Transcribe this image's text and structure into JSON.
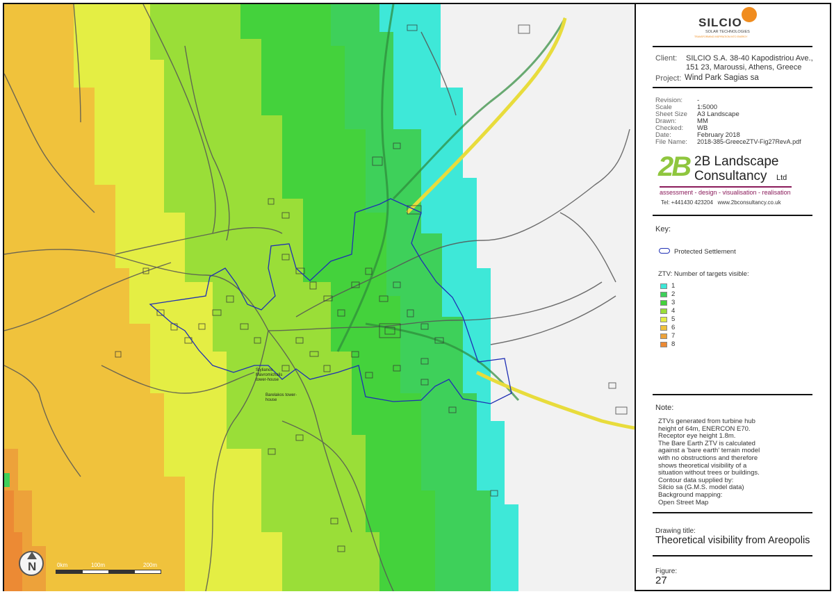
{
  "map": {
    "scale_bar": {
      "labels": [
        "0km",
        "100m",
        "200m"
      ]
    },
    "place_labels": [
      "Stylianos Mavromichalis tower-house",
      "Barelakos tower-house"
    ],
    "north_arrow_letter": "N",
    "colors": {
      "band_1": "#3ee8d8",
      "band_2": "#3ed05a",
      "band_3": "#44d23c",
      "band_4": "#9ade38",
      "band_5": "#e4ee44",
      "band_6": "#f0c23c",
      "band_7": "#eda23a",
      "band_8": "#ec8a34",
      "protected_settlement": "#1f2fb4",
      "road_main": "#e8dc3c"
    }
  },
  "panel": {
    "logo": {
      "name": "SILCIO",
      "sub": "SOLAR TECHNOLOGIES",
      "tagline": "TRANSFORMING INSPIRATION INTO ENERGY"
    },
    "client_label": "Client:",
    "client_value_line1": "SILCIO S.A. 38-40 Kapodistriou Ave.,",
    "client_value_line2": "151 23, Maroussi, Athens, Greece",
    "project_label": "Project:",
    "project_value": "Wind Park Sagias sa",
    "meta": [
      {
        "key": "Revision:",
        "value": "-"
      },
      {
        "key": "Scale",
        "value": "1:5000"
      },
      {
        "key": "Sheet Size",
        "value": "A3 Landscape"
      },
      {
        "key": "Drawn:",
        "value": "MM"
      },
      {
        "key": "Checked:",
        "value": "WB"
      },
      {
        "key": "Date:",
        "value": "February 2018"
      },
      {
        "key": "File Name:",
        "value": "2018-385-GreeceZTV-Fig27RevA.pdf"
      }
    ],
    "consultancy": {
      "mark": "2B",
      "line1": "2B Landscape",
      "line2": "Consultancy",
      "ltd": "Ltd",
      "services": "assessment - design - visualisation - realisation",
      "contact": "Tel: +441430 423204   www.2bconsultancy.co.uk"
    },
    "key_title": "Key:",
    "protected_label": "Protected Settlement",
    "ztv_title": "ZTV: Number of targets visible:",
    "ztv_items": [
      {
        "n": "1",
        "color": "#3ee8d8"
      },
      {
        "n": "2",
        "color": "#3ed05a"
      },
      {
        "n": "3",
        "color": "#44d23c"
      },
      {
        "n": "4",
        "color": "#9ade38"
      },
      {
        "n": "5",
        "color": "#e4ee44"
      },
      {
        "n": "6",
        "color": "#f0c23c"
      },
      {
        "n": "7",
        "color": "#eda23a"
      },
      {
        "n": "8",
        "color": "#ec8a34"
      }
    ],
    "note_title": "Note:",
    "note_lines": [
      "ZTVs generated from turbine hub",
      "height of 64m, ENERCON E70.",
      "Receptor eye height 1.8m.",
      "The Bare Earth ZTV is calculated",
      "against a 'bare earth' terrain model",
      "with no obstructions and therefore",
      "shows theoretical visibility of a",
      "situation without trees or buildings.",
      "Contour data supplied by:",
      "Silcio sa (G.M.S. model data)",
      "Background mapping:",
      "Open Street Map"
    ],
    "drawing_title_label": "Drawing title:",
    "drawing_title": "Theoretical visibility from Areopolis",
    "figure_label": "Figure:",
    "figure_number": "27"
  }
}
